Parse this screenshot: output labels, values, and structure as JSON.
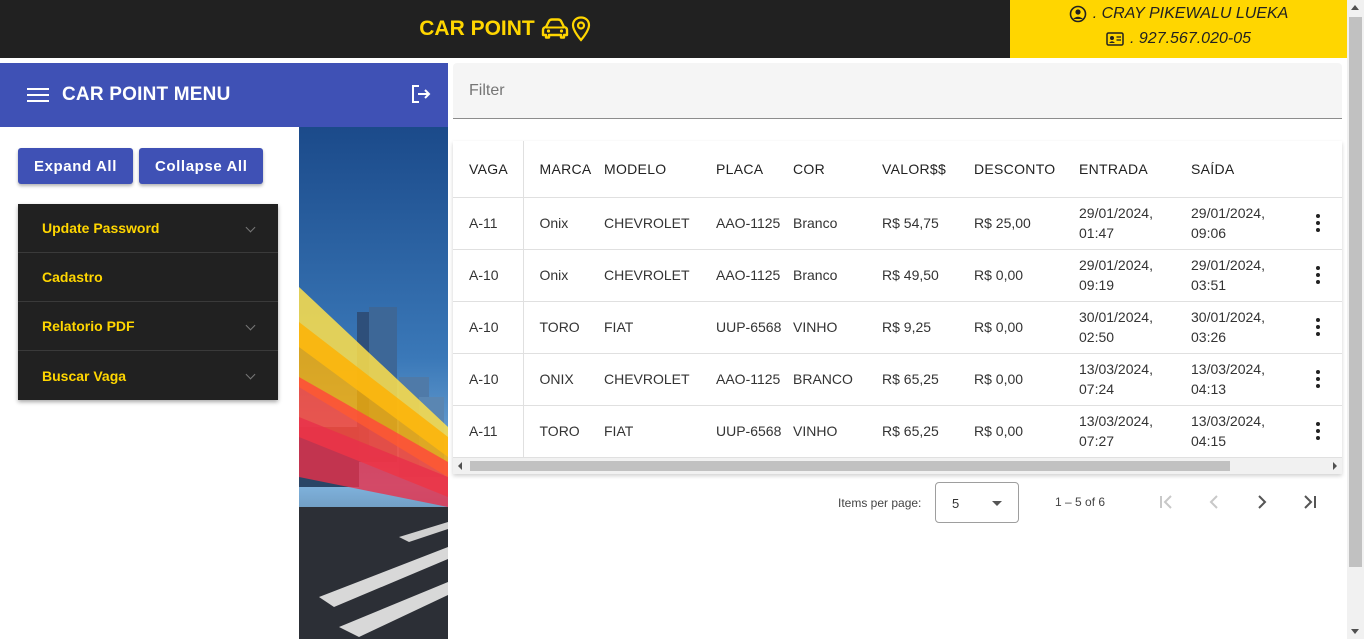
{
  "header": {
    "brand": "CAR POINT",
    "user_name": ". CRAY PIKEWALU LUEKA",
    "user_doc": ". 927.567.020-05"
  },
  "sidebar": {
    "title": "CAR POINT MENU",
    "expand_label": "Expand All",
    "collapse_label": "Collapse All",
    "items": [
      {
        "label": "Update Password",
        "expandable": true
      },
      {
        "label": "Cadastro",
        "expandable": false
      },
      {
        "label": "Relatorio PDF",
        "expandable": true
      },
      {
        "label": "Buscar Vaga",
        "expandable": true
      }
    ]
  },
  "filter": {
    "label": "Filter"
  },
  "table": {
    "headers": [
      "VAGA",
      "MARCA",
      "MODELO",
      "PLACA",
      "COR",
      "VALOR$$",
      "DESCONTO",
      "ENTRADA",
      "SAÍDA"
    ],
    "rows": [
      [
        "A-11",
        "Onix",
        "CHEVROLET",
        "AAO-1125",
        "Branco",
        "R$ 54,75",
        "R$ 25,00",
        "29/01/2024, 01:47",
        "29/01/2024, 09:06"
      ],
      [
        "A-10",
        "Onix",
        "CHEVROLET",
        "AAO-1125",
        "Branco",
        "R$ 49,50",
        "R$ 0,00",
        "29/01/2024, 09:19",
        "29/01/2024, 03:51"
      ],
      [
        "A-10",
        "TORO",
        "FIAT",
        "UUP-6568",
        "VINHO",
        "R$ 9,25",
        "R$ 0,00",
        "30/01/2024, 02:50",
        "30/01/2024, 03:26"
      ],
      [
        "A-10",
        "ONIX",
        "CHEVROLET",
        "AAO-1125",
        "BRANCO",
        "R$ 65,25",
        "R$ 0,00",
        "13/03/2024, 07:24",
        "13/03/2024, 04:13"
      ],
      [
        "A-11",
        "TORO",
        "FIAT",
        "UUP-6568",
        "VINHO",
        "R$ 65,25",
        "R$ 0,00",
        "13/03/2024, 07:27",
        "13/03/2024, 04:15"
      ]
    ]
  },
  "paginator": {
    "items_label": "Items per page:",
    "page_size": "5",
    "range": "1 – 5 of 6"
  },
  "colors": {
    "header_bg": "#212121",
    "accent_yellow": "#ffd600",
    "primary": "#3f51b5"
  }
}
